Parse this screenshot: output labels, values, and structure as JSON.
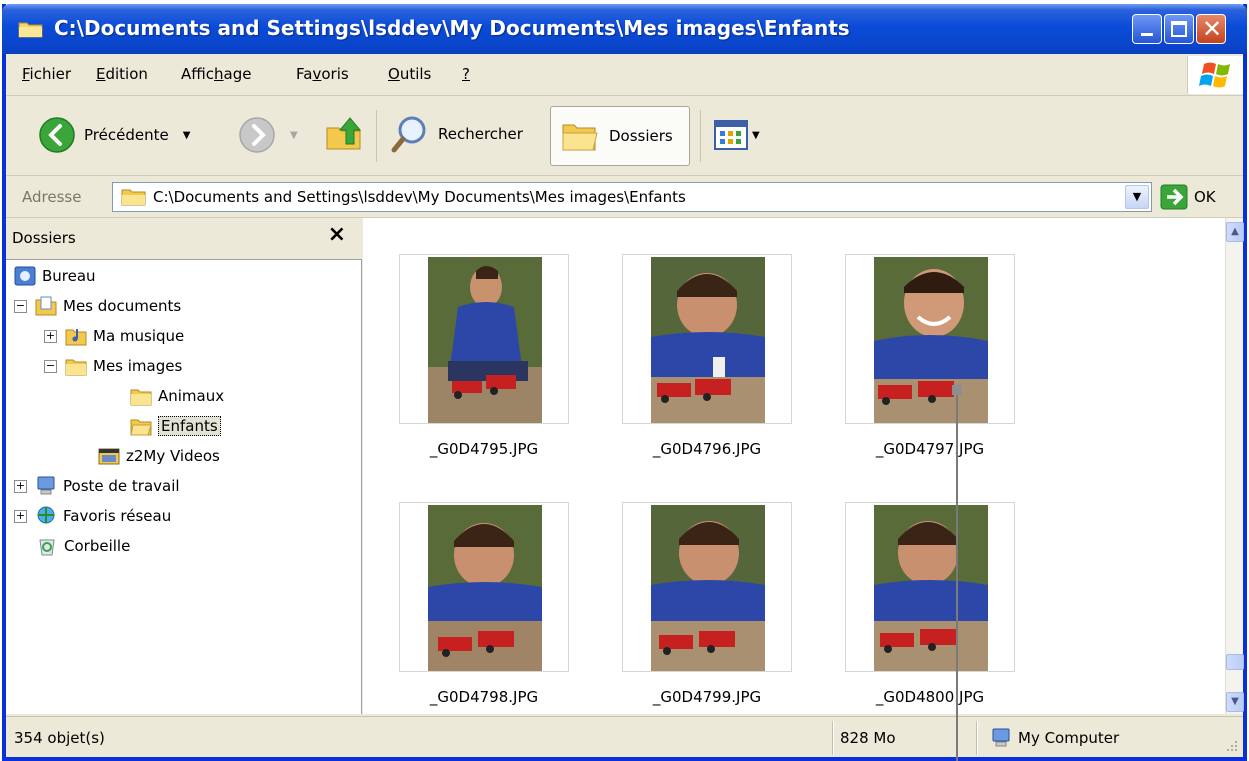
{
  "window": {
    "title": "C:\\Documents and Settings\\lsddev\\My Documents\\Mes images\\Enfants"
  },
  "menu": [
    {
      "label_u": "F",
      "label_rest": "ichier"
    },
    {
      "label_u": "E",
      "label_rest": "dition"
    },
    {
      "label_pre": "Affic",
      "label_u": "h",
      "label_rest": "age"
    },
    {
      "label_pre": "Fa",
      "label_u": "v",
      "label_rest": "oris"
    },
    {
      "label_u": "O",
      "label_rest": "utils"
    },
    {
      "label_u": "?",
      "label_rest": ""
    }
  ],
  "toolbar": {
    "back_label": "Précédente",
    "search_label": "Rechercher",
    "folders_label": "Dossiers"
  },
  "address": {
    "label": "Adresse",
    "value": "C:\\Documents and Settings\\lsddev\\My Documents\\Mes images\\Enfants",
    "go_label": "OK"
  },
  "folders_pane": {
    "title": "Dossiers",
    "close": "×",
    "tree": [
      {
        "label": "Bureau"
      },
      {
        "label": "Mes documents"
      },
      {
        "label": "Ma musique"
      },
      {
        "label": "Mes images"
      },
      {
        "label": "Animaux"
      },
      {
        "label": "Enfants"
      },
      {
        "label": "z2My Videos"
      },
      {
        "label": "Poste de travail"
      },
      {
        "label": "Favoris réseau"
      },
      {
        "label": "Corbeille"
      }
    ]
  },
  "files": [
    {
      "name": "_G0D4795.JPG"
    },
    {
      "name": "_G0D4796.JPG"
    },
    {
      "name": "_G0D4797.JPG"
    },
    {
      "name": "_G0D4798.JPG"
    },
    {
      "name": "_G0D4799.JPG"
    },
    {
      "name": "_G0D4800.JPG"
    }
  ],
  "status": {
    "objects": "354 objet(s)",
    "size": "828 Mo",
    "zone": "My Computer"
  },
  "colors": {
    "title_blue": "#0a4bd8",
    "window_bg": "#ece9d8",
    "close_red": "#c3421f"
  }
}
